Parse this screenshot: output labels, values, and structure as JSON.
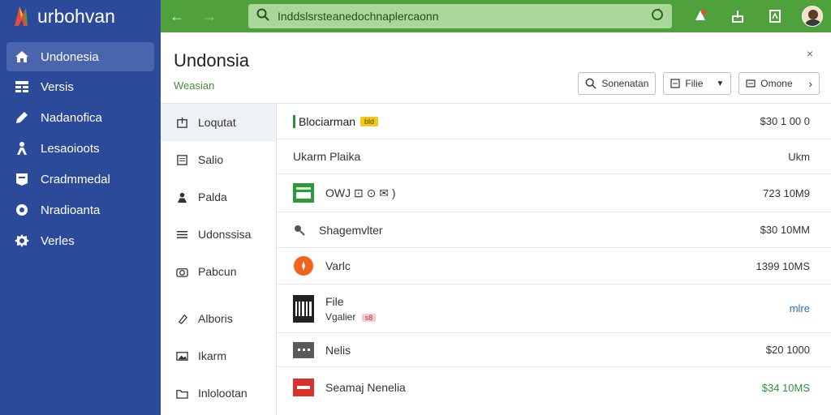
{
  "app": {
    "brand": "urbohvan",
    "search_placeholder": "Inddslsrsteanedochnaplercaonn"
  },
  "sidebar": {
    "items": [
      {
        "label": "Undonesia",
        "icon": "home-icon"
      },
      {
        "label": "Versis",
        "icon": "table-icon"
      },
      {
        "label": "Nadanofica",
        "icon": "pencil-icon"
      },
      {
        "label": "Lesaoioots",
        "icon": "person-icon"
      },
      {
        "label": "Cradmmedal",
        "icon": "badge-icon"
      },
      {
        "label": "Nradioanta",
        "icon": "gear-icon"
      },
      {
        "label": "Verles",
        "icon": "settings-icon"
      }
    ]
  },
  "header": {
    "title": "Undonsia",
    "subtitle": "Weasian",
    "buttons": {
      "search": "Sonenatan",
      "file": "Filie",
      "more": "Omone"
    }
  },
  "submenu": {
    "items": [
      {
        "label": "Loqutat"
      },
      {
        "label": "Salio"
      },
      {
        "label": "Palda"
      },
      {
        "label": "Udonssisa"
      },
      {
        "label": "Pabcun"
      },
      {
        "label": "Alboris"
      },
      {
        "label": "Ikarm"
      },
      {
        "label": "Inlolootan"
      }
    ]
  },
  "list": {
    "rows": [
      {
        "title": "Blociarman",
        "tag": "bld",
        "value": "$30 1 00 0"
      },
      {
        "title": "Ukarm Plaika",
        "value": "Ukm"
      },
      {
        "title": "OWJ ⊡   ⊙ ✉ )",
        "value": "723 10M9"
      },
      {
        "title": "Shagemvlter",
        "value": "$30 10MM"
      },
      {
        "title": "Varlc",
        "value": "1399 10MS"
      },
      {
        "title": "File",
        "sub": "Vgalier",
        "tag": "s8",
        "value": "mlre"
      },
      {
        "title": "Nelis",
        "value": "$20 1000"
      },
      {
        "title": "Seamaj Nenelia",
        "value": "$34 10MS"
      }
    ]
  },
  "colors": {
    "sidebar": "#2b4a9a",
    "topbar": "#4ea13b",
    "accent_green": "#2f8f3b",
    "link_blue": "#2a6fb3"
  }
}
